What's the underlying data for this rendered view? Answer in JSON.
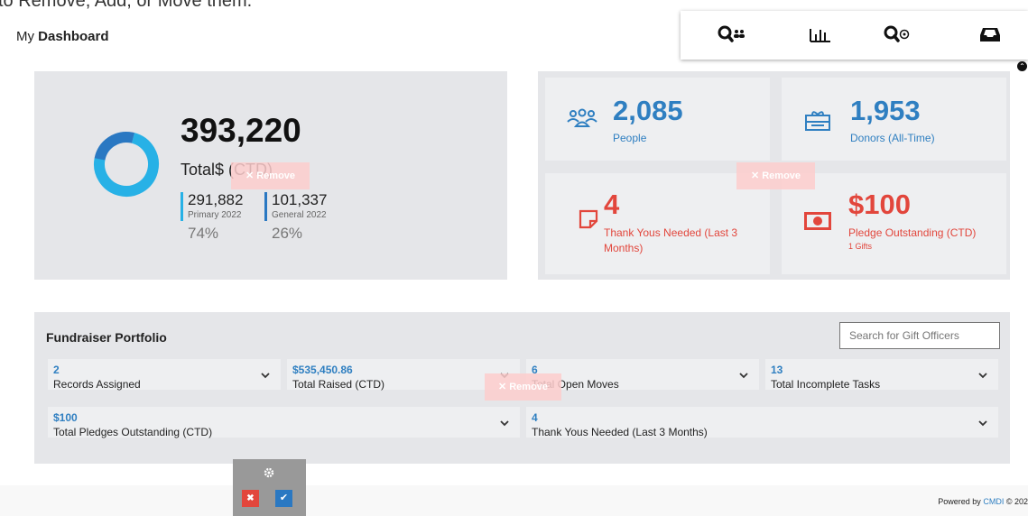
{
  "instructions_text": "to Remove, Add, or Move them.",
  "header": {
    "title_prefix": "My",
    "title_bold": "Dashboard"
  },
  "toolbar": {
    "icons": [
      "people-search-icon",
      "bar-chart-icon",
      "record-search-icon",
      "inbox-icon"
    ]
  },
  "total_panel": {
    "total": "393,220",
    "total_label": "Total$ (CTD)",
    "donut_fractions": [
      0.74,
      0.26
    ],
    "colors": {
      "primary": "#27b1e6",
      "general": "#2a78c2"
    },
    "primary": {
      "value": "291,882",
      "label": "Primary 2022",
      "pct": "74%"
    },
    "general": {
      "value": "101,337",
      "label": "General 2022",
      "pct": "26%"
    }
  },
  "remove_label": "✕ Remove",
  "stats": {
    "people": {
      "value": "2,085",
      "label": "People"
    },
    "donors": {
      "value": "1,953",
      "label": "Donors (All-Time)"
    },
    "thank_yous": {
      "value": "4",
      "label": "Thank Yous Needed (Last 3 Months)"
    },
    "pledges": {
      "value": "$100",
      "label": "Pledge Outstanding (CTD)",
      "sub": "1 Gifts"
    }
  },
  "fundraiser": {
    "title": "Fundraiser Portfolio",
    "search_placeholder": "Search for Gift Officers",
    "cards": [
      {
        "value": "2",
        "label": "Records Assigned"
      },
      {
        "value": "$535,450.86",
        "label": "Total Raised (CTD)"
      },
      {
        "value": "6",
        "label": "Total Open Moves"
      },
      {
        "value": "13",
        "label": "Total Incomplete Tasks"
      },
      {
        "value": "$100",
        "label": "Total Pledges Outstanding (CTD)"
      },
      {
        "value": "4",
        "label": "Thank Yous Needed (Last 3 Months)"
      }
    ]
  },
  "footer": {
    "powered": "Powered by",
    "brand": "CMDI",
    "copy": "© 202"
  },
  "edit": {
    "cancel": "✖",
    "confirm": "✔",
    "settings_icon": "gear-icon"
  },
  "accent_colors": {
    "blue": "#2f7fc1",
    "red": "#e2463c"
  }
}
